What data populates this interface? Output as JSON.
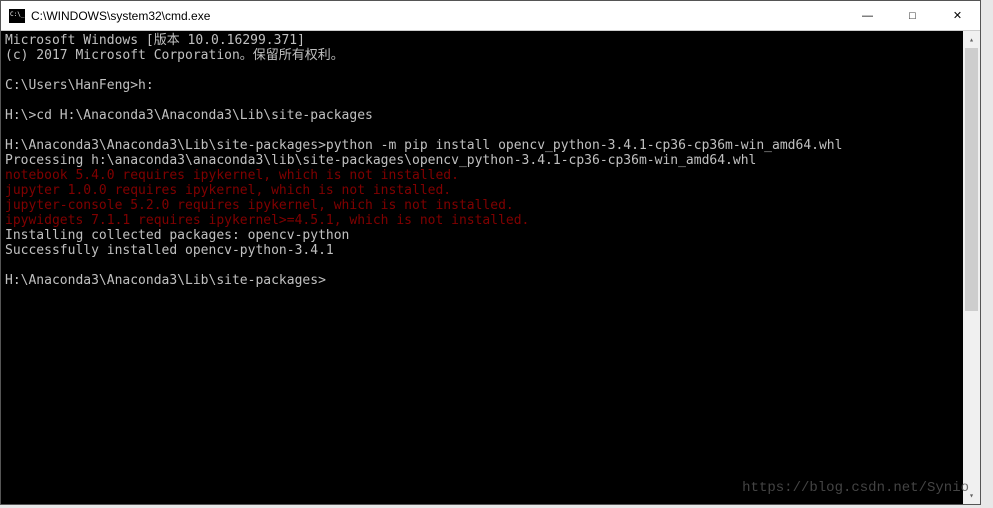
{
  "window": {
    "title": "C:\\WINDOWS\\system32\\cmd.exe"
  },
  "controls": {
    "minimize": "—",
    "maximize": "□",
    "close": "✕"
  },
  "scrollbar": {
    "up": "▴",
    "down": "▾"
  },
  "terminal": {
    "lines": [
      {
        "text": "Microsoft Windows [版本 10.0.16299.371]",
        "cls": ""
      },
      {
        "text": "(c) 2017 Microsoft Corporation。保留所有权利。",
        "cls": ""
      },
      {
        "text": "",
        "cls": ""
      },
      {
        "text": "C:\\Users\\HanFeng>h:",
        "cls": ""
      },
      {
        "text": "",
        "cls": ""
      },
      {
        "text": "H:\\>cd H:\\Anaconda3\\Anaconda3\\Lib\\site-packages",
        "cls": ""
      },
      {
        "text": "",
        "cls": ""
      },
      {
        "text": "H:\\Anaconda3\\Anaconda3\\Lib\\site-packages>python -m pip install opencv_python-3.4.1-cp36-cp36m-win_amd64.whl",
        "cls": ""
      },
      {
        "text": "Processing h:\\anaconda3\\anaconda3\\lib\\site-packages\\opencv_python-3.4.1-cp36-cp36m-win_amd64.whl",
        "cls": ""
      },
      {
        "text": "notebook 5.4.0 requires ipykernel, which is not installed.",
        "cls": "red"
      },
      {
        "text": "jupyter 1.0.0 requires ipykernel, which is not installed.",
        "cls": "red"
      },
      {
        "text": "jupyter-console 5.2.0 requires ipykernel, which is not installed.",
        "cls": "red"
      },
      {
        "text": "ipywidgets 7.1.1 requires ipykernel>=4.5.1, which is not installed.",
        "cls": "red"
      },
      {
        "text": "Installing collected packages: opencv-python",
        "cls": ""
      },
      {
        "text": "Successfully installed opencv-python-3.4.1",
        "cls": ""
      },
      {
        "text": "",
        "cls": ""
      },
      {
        "text": "H:\\Anaconda3\\Anaconda3\\Lib\\site-packages>",
        "cls": ""
      }
    ]
  },
  "watermark": "https://blog.csdn.net/Synio"
}
